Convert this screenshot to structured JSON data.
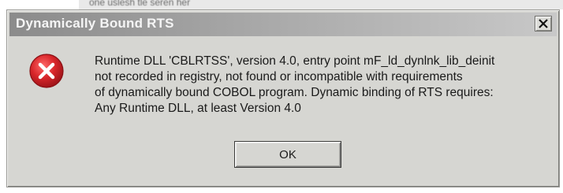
{
  "background": {
    "partial_text": "one uslesh tle seren her"
  },
  "dialog": {
    "title": "Dynamically Bound RTS",
    "close_icon": "close-x-icon",
    "icon": "error-icon",
    "message_lines": [
      "Runtime DLL 'CBLRTSS', version 4.0, entry point mF_ld_dynlnk_lib_deinit",
      "not recorded in registry, not found or incompatible with requirements",
      "of dynamically bound COBOL program.  Dynamic binding of RTS requires:",
      "Any Runtime DLL, at least Version 4.0"
    ],
    "ok_label": "OK"
  },
  "colors": {
    "title_bar_start": "#8b8b8b",
    "title_bar_end": "#c8c8c8",
    "dialog_face": "#d6d6d2",
    "error_red": "#d8262a"
  }
}
